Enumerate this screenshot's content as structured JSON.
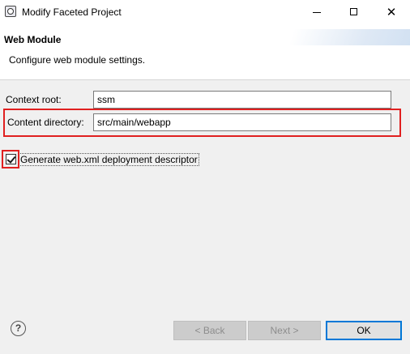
{
  "window": {
    "title": "Modify Faceted Project",
    "minimize_glyph": "",
    "maximize_glyph": "",
    "close_glyph": "✕"
  },
  "header": {
    "title": "Web Module",
    "description": "Configure web module settings."
  },
  "form": {
    "context_root": {
      "label": "Context root:",
      "value": "ssm"
    },
    "content_directory": {
      "label": "Content directory:",
      "value": "src/main/webapp"
    },
    "generate_descriptor": {
      "label": "Generate web.xml deployment descriptor",
      "checked": true
    }
  },
  "buttons": {
    "help": "?",
    "back": "< Back",
    "next": "Next >",
    "ok": "OK"
  },
  "colors": {
    "highlight": "#e02020",
    "content_bg": "#f0f0f0"
  },
  "icons": {
    "app": "eclipse-icon",
    "minimize": "minimize-icon",
    "maximize": "maximize-icon",
    "close": "close-icon",
    "help": "help-icon"
  }
}
